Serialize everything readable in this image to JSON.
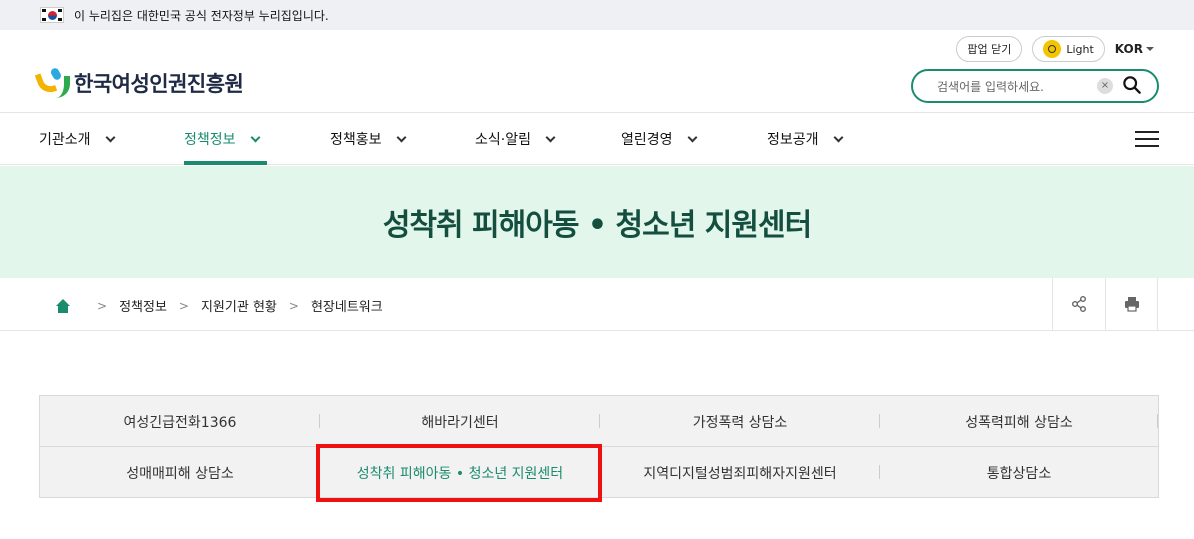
{
  "gov_banner": {
    "text": "이 누리집은 대한민국 공식 전자정부 누리집입니다."
  },
  "header": {
    "logo_text": "한국여성인권진흥원",
    "popup_close": "팝업 닫기",
    "theme": "Light",
    "lang": "KOR",
    "search_placeholder": "검색어를 입력하세요."
  },
  "gnb": [
    {
      "label": "기관소개"
    },
    {
      "label": "정책정보",
      "active": true
    },
    {
      "label": "정책홍보"
    },
    {
      "label": "소식·알림"
    },
    {
      "label": "열린경영"
    },
    {
      "label": "정보공개"
    }
  ],
  "page_title": "성착취 피해아동 • 청소년 지원센터",
  "breadcrumb": [
    "정책정보",
    "지원기관 현황",
    "현장네트워크"
  ],
  "tabs": [
    [
      "여성긴급전화1366",
      "해바라기센터",
      "가정폭력 상담소",
      "성폭력피해 상담소"
    ],
    [
      "성매매피해 상담소",
      "성착취 피해아동 • 청소년 지원센터",
      "지역디지털성범죄피해자지원센터",
      "통합상담소"
    ]
  ],
  "colors": {
    "accent": "#1a8c6d",
    "title_band": "#e2f6ec",
    "highlight": "#e11111"
  }
}
